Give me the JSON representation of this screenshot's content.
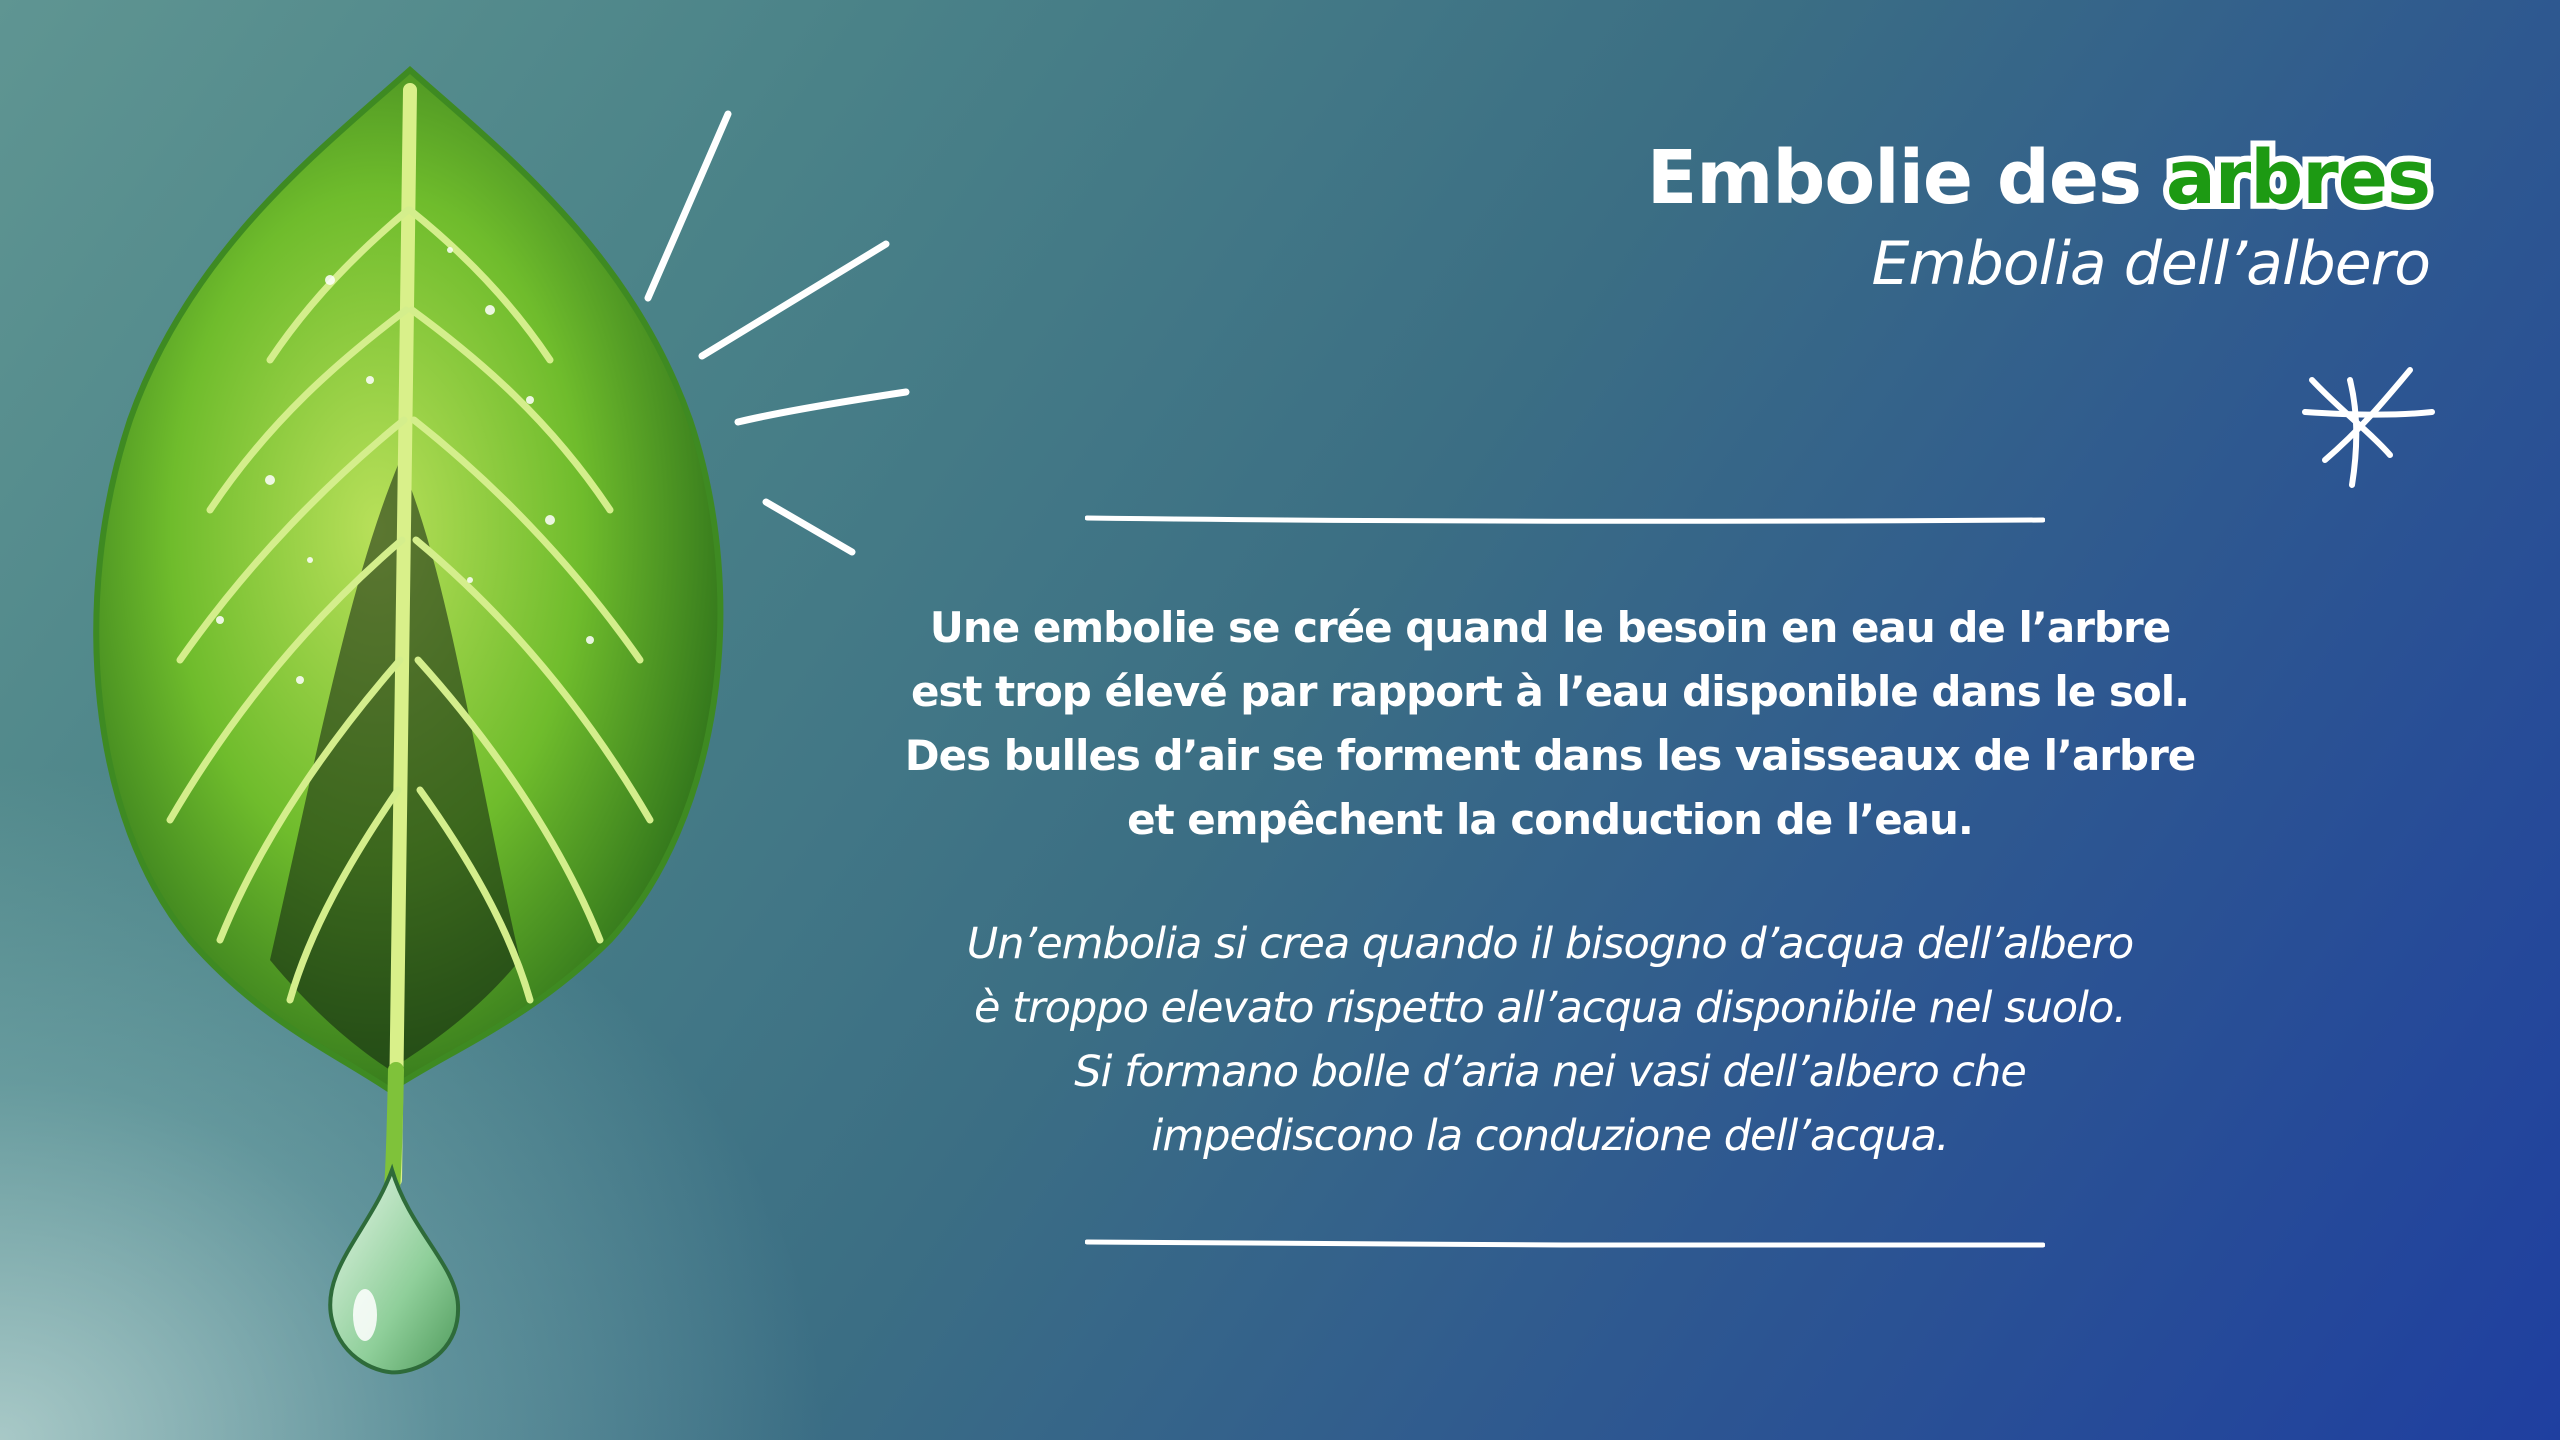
{
  "title": {
    "prefix": "Embolie des",
    "accent": "arbres",
    "subtitle": "Embolia dell’albero"
  },
  "body": {
    "fr_lines": [
      "Une embolie se crée quand le besoin en eau de l’arbre",
      "est trop élevé par rapport à l’eau disponible dans le sol.",
      "Des bulles d’air se forment dans les vaisseaux de l’arbre",
      "et empêchent la conduction de l’eau."
    ],
    "it_lines": [
      "Un’embolia si crea quando il bisogno d’acqua dell’albero",
      "è troppo elevato rispetto all’acqua disponibile nel suolo.",
      "Si formano bolle d’aria nei vasi dell’albero che",
      "impediscono la conduzione dell’acqua."
    ]
  },
  "illustration": {
    "main": "leaf-with-water-drop-icon",
    "decorations": [
      "burst-lines-icon",
      "sparkle-icon"
    ]
  },
  "colors": {
    "accent_green": "#1d9a13",
    "leaf_light": "#9ed34a",
    "leaf_dark": "#2f7a1c",
    "background_start": "#5f9592",
    "background_end": "#1f3fa0",
    "text": "#ffffff"
  }
}
